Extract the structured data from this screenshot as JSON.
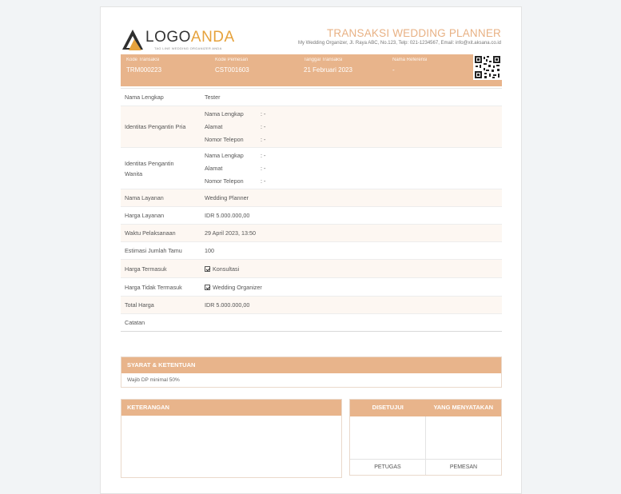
{
  "logo": {
    "text_main": "LOGO",
    "text_accent": "ANDA",
    "tagline": "TAG LINE WEDDING ORGANIZER ANDA"
  },
  "header": {
    "title": "TRANSAKSI WEDDING PLANNER",
    "subtitle": "My Wedding Organizer, Jl. Raya ABC, No.123, Telp: 021-1234567, Email: info@xit.aksana.co.id"
  },
  "summary": {
    "fields": [
      {
        "label": "Kode Transaksi",
        "value": "TRM000223"
      },
      {
        "label": "Kode Pemesan",
        "value": "CST001603"
      },
      {
        "label": "Tanggal Transaksi",
        "value": "21 Februari 2023"
      },
      {
        "label": "Nama Referensi",
        "value": "-"
      }
    ]
  },
  "details": {
    "nama_lengkap": {
      "label": "Nama Lengkap",
      "value": "Tester"
    },
    "pengantin_pria": {
      "label": "Identitas Pengantin Pria",
      "lines": [
        {
          "key": "Nama Lengkap",
          "value": ": -"
        },
        {
          "key": "Alamat",
          "value": ": -"
        },
        {
          "key": "Nomor Telepon",
          "value": ": -"
        }
      ]
    },
    "pengantin_wanita": {
      "label_1": "Identitas Pengantin",
      "label_2": "Wanita",
      "lines": [
        {
          "key": "Nama Lengkap",
          "value": ": -"
        },
        {
          "key": "Alamat",
          "value": ": -"
        },
        {
          "key": "Nomor Telepon",
          "value": ": -"
        }
      ]
    },
    "nama_layanan": {
      "label": "Nama Layanan",
      "value": "Wedding Planner"
    },
    "harga_layanan": {
      "label": "Harga Layanan",
      "value": "IDR 5.000.000,00"
    },
    "waktu": {
      "label": "Waktu Pelaksanaan",
      "value": "29 April 2023, 13:50"
    },
    "tamu": {
      "label": "Estimasi Jumlah Tamu",
      "value": "100"
    },
    "termasuk": {
      "label": "Harga Termasuk",
      "value": "Konsultasi"
    },
    "tidak_termasuk": {
      "label": "Harga Tidak Termasuk",
      "value": "Wedding Organizer"
    },
    "total": {
      "label": "Total Harga",
      "value": "IDR 5.000.000,00"
    },
    "catatan": {
      "label": "Catatan",
      "value": ""
    }
  },
  "terms": {
    "title": "SYARAT & KETENTUAN",
    "body": "Wajib DP minimal 50%"
  },
  "notes": {
    "title": "KETERANGAN"
  },
  "signature": {
    "head_left": "DISETUJUI",
    "head_right": "YANG MENYATAKAN",
    "foot_left": "PETUGAS",
    "foot_right": "PEMESAN"
  },
  "colors": {
    "accent": "#e8b48b",
    "title": "#e8b184",
    "row_alt": "#fdf7f2",
    "logo_accent": "#e6a23c"
  }
}
